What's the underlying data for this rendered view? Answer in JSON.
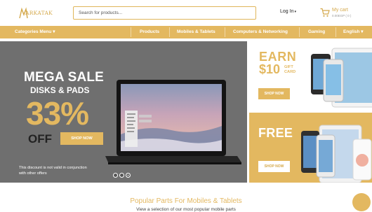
{
  "header": {
    "logo_text": "ARKATAK",
    "search_placeholder": "Search for products...",
    "login_label": "Log In",
    "cart_title": "My cart",
    "cart_sub": "0.00EGP ( 0 )"
  },
  "nav": {
    "categories_label": "Categories Menu",
    "items": [
      "Products",
      "Mobiles & Tablets",
      "Computers & Networking",
      "Gaming"
    ],
    "language_label": "English"
  },
  "hero": {
    "title": "MEGA SALE",
    "subtitle": "DISKS & PADS",
    "percent": "33%",
    "off": "OFF",
    "button": "SHOP NOW",
    "note": "This discount is not valid in conjunction with other offers",
    "slides": 3,
    "active_slide": 3
  },
  "promo_top": {
    "earn": "EARN",
    "amount": "$10",
    "gift_line1": "GIFT",
    "gift_line2": "CARD",
    "button": "SHOP NOW"
  },
  "promo_bottom": {
    "title": "FREE",
    "button": "SHOP NOW"
  },
  "section": {
    "title": "Popular Parts For Mobiles & Tablets",
    "subtitle": "View a selection of our most popular mobile parts"
  },
  "colors": {
    "accent": "#e3b860",
    "hero_bg": "#6f6f6f"
  },
  "icons": [
    "cart-icon",
    "chevron-down-icon",
    "chat-icon"
  ]
}
